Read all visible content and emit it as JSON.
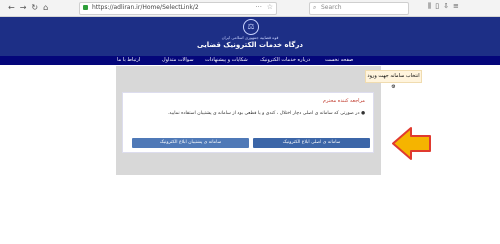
{
  "browser": {
    "url": "https://adliran.ir/Home/SelectLink/2",
    "search_placeholder": "Search"
  },
  "header": {
    "judiciary": "قوه قضاییه جمهوری اسلامی ایران",
    "title": "درگاه خدمات الکترونیک قضایی"
  },
  "menu": {
    "items": [
      "صفحه نخست",
      "درباره خدمات الکترونیک",
      "شکایات و پیشنهادات",
      "سوالات متداول",
      "ارتباط با ما"
    ]
  },
  "content": {
    "system_title": "انتخاب سامانه جهت ورود",
    "greeting": "مراجعه کننده محترم",
    "notice": "در صورتی که سامانه ی اصلی دچار اختلال ، کندی و یا قطعی بود از سامانه ی پشتیبان استفاده نمایید.",
    "primary_button": "سامانه ی اصلی ابلاغ الکترونیک",
    "secondary_button": "سامانه ی پشتیبان ابلاغ الکترونیک"
  },
  "colors": {
    "header_bg": "#1d2f86",
    "menu_bg": "#04067a",
    "button": "#4f79b7",
    "arrow_fill": "#f5b400",
    "arrow_stroke": "#e03a2f"
  }
}
